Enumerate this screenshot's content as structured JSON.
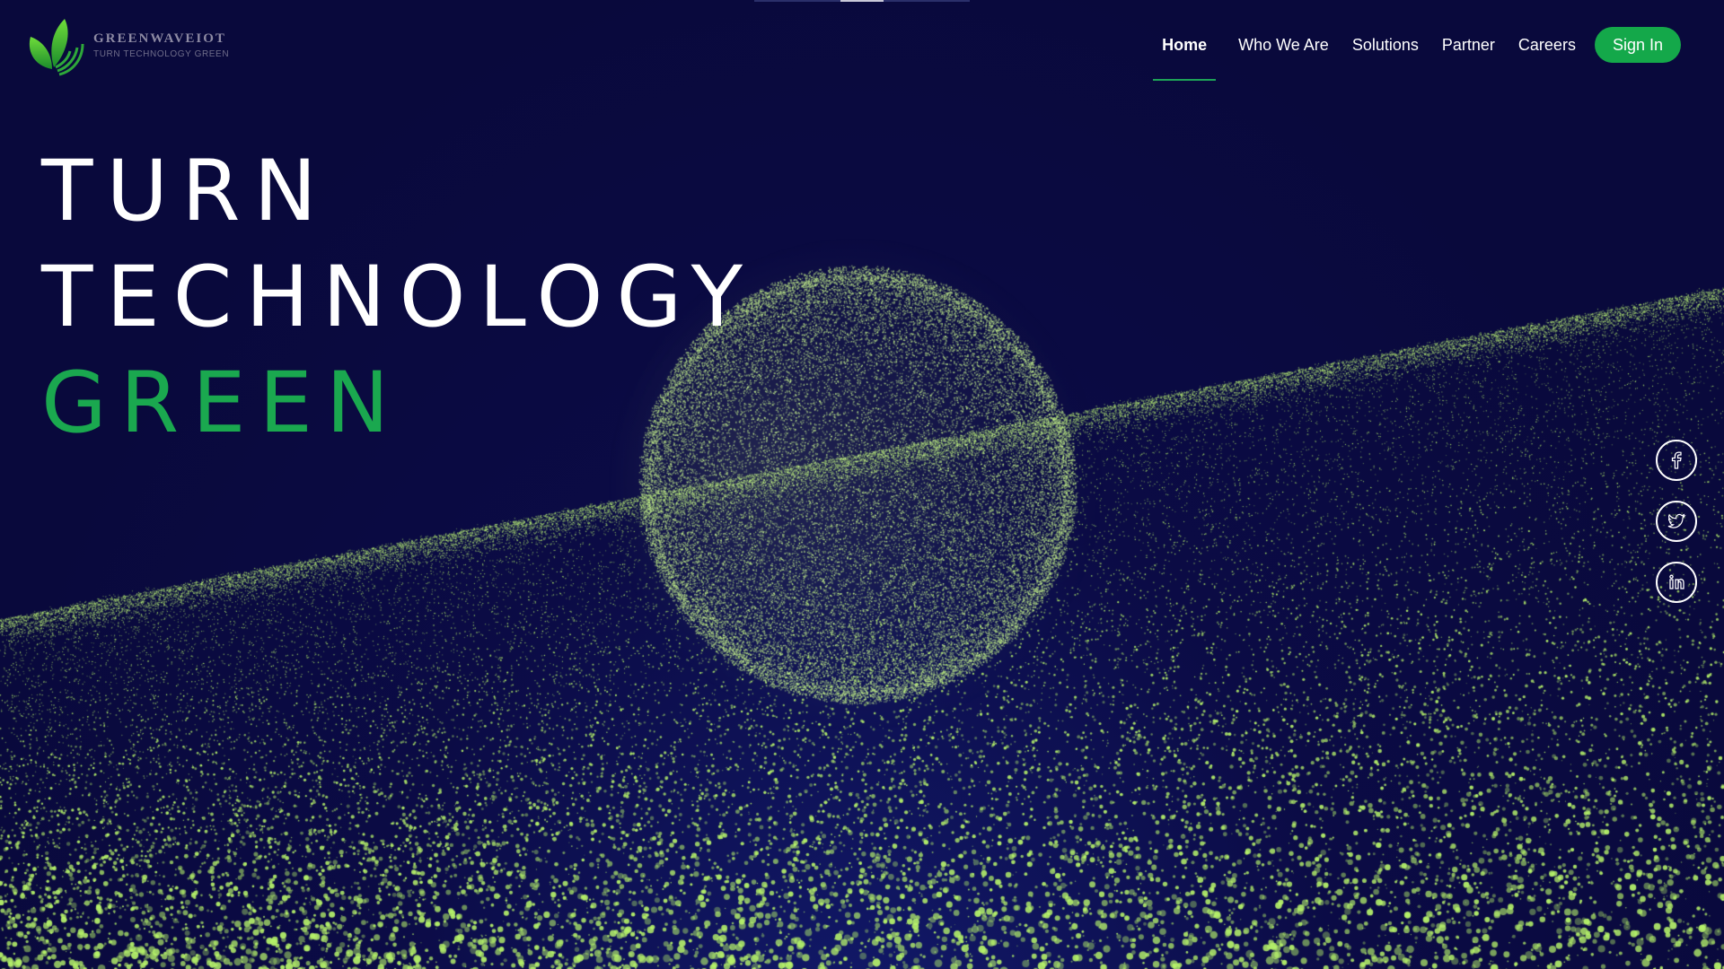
{
  "brand": {
    "name": "GREENWAVEIOT",
    "tagline": "TURN TECHNOLOGY GREEN",
    "logo_icon": "leaf-wave-logo"
  },
  "nav": {
    "items": [
      {
        "label": "Home",
        "active": true
      },
      {
        "label": "Who We Are"
      },
      {
        "label": "Solutions"
      },
      {
        "label": "Partner"
      },
      {
        "label": "Careers"
      }
    ],
    "sign_in": "Sign In"
  },
  "hero": {
    "line1": "TURN",
    "line2": "TECHNOLOGY",
    "line3": "GREEN"
  },
  "social": [
    {
      "icon": "facebook-icon"
    },
    {
      "icon": "twitter-icon"
    },
    {
      "icon": "linkedin-icon"
    }
  ],
  "colors": {
    "background": "#0a0a3f",
    "accent_green": "#14a84a",
    "particle": "#b6f26a"
  }
}
